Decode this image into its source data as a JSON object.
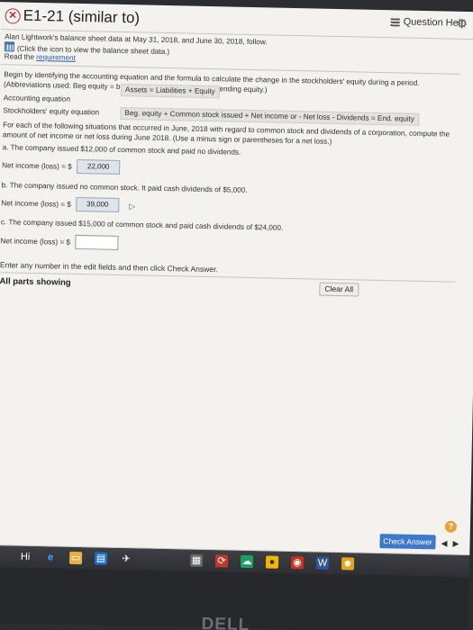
{
  "header": {
    "title": "E1-21 (similar to)",
    "question_help": "Question Help",
    "close_glyph": "✕",
    "settings_glyph": "⚙"
  },
  "intro": {
    "line1": "Alan Lightwork's balance sheet data at May 31, 2018, and June 30, 2018, follow.",
    "line2": "(Click the icon to view the balance sheet data.)",
    "read_the": "Read the",
    "requirement": "requirement"
  },
  "instructions": {
    "begin": "Begin by identifying the accounting equation and the formula to calculate the change in the stockholders' equity during a period. (Abbreviations used: Beg equity = beginning equity; End. equity = ending equity.)",
    "accounting_label": "Accounting equation",
    "accounting_eq": "Assets = Liabilities + Equity",
    "se_label": "Stockholders' equity equation",
    "se_eq": "Beg. equity + Common stock issued + Net income or - Net loss - Dividends = End. equity",
    "situations": "For each of the following situations that occurred in June, 2018 with regard to common stock and dividends of a corporation, compute the amount of net income or net loss during June 2018. (Use a minus sign or parentheses for a net loss.)"
  },
  "parts": {
    "a_text": "a. The company issued $12,000 of common stock and paid no dividends.",
    "a_label": "Net income (loss) = $",
    "a_value": "22,000",
    "b_text": "b. The company issued no common stock. It paid cash dividends of $5,000.",
    "b_label": "Net income (loss) = $",
    "b_value": "39,000",
    "c_text": "c. The company issued $15,000 of common stock and paid cash dividends of $24,000.",
    "c_label": "Net income (loss) = $",
    "c_value": ""
  },
  "footer": {
    "enter_text": "Enter any number in the edit fields and then click Check Answer.",
    "all_parts": "All parts showing",
    "clear_all": "Clear All",
    "check_answer": "Check Answer",
    "prev_glyph": "◀",
    "next_glyph": "▶",
    "help_glyph": "?"
  },
  "taskbar": {
    "icons": [
      "Hi",
      "e",
      "▭",
      "▤",
      "✈",
      "▦",
      "⟳",
      "☁",
      "●",
      "◉",
      "W",
      "☻"
    ]
  },
  "brand": {
    "bezel_logo": "DELL"
  },
  "colors": {
    "accent": "#3d78c9",
    "link": "#2d5fa8",
    "page_bg": "#f3f2ef"
  }
}
